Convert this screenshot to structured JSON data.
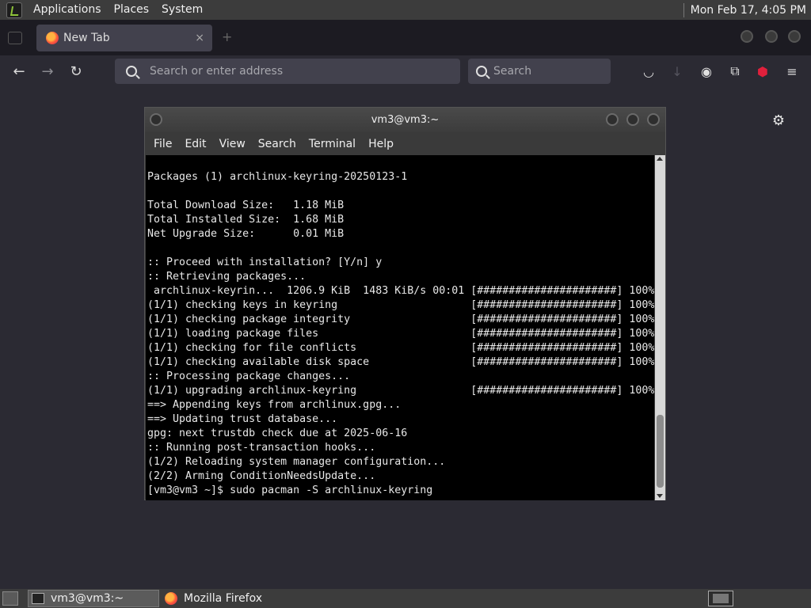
{
  "top_panel": {
    "menus": [
      "Applications",
      "Places",
      "System"
    ],
    "clock": "Mon Feb 17,  4:05 PM"
  },
  "firefox": {
    "tab": {
      "title": "New Tab",
      "close": "×"
    },
    "urlbar": {
      "placeholder": "Search or enter address"
    },
    "searchbar": {
      "placeholder": "Search"
    }
  },
  "terminal": {
    "title": "vm3@vm3:~",
    "menus": [
      "File",
      "Edit",
      "View",
      "Search",
      "Terminal",
      "Help"
    ],
    "lines": [
      "Packages (1) archlinux-keyring-20250123-1",
      "",
      "Total Download Size:   1.18 MiB",
      "Total Installed Size:  1.68 MiB",
      "Net Upgrade Size:      0.01 MiB",
      "",
      ":: Proceed with installation? [Y/n] y",
      ":: Retrieving packages...",
      " archlinux-keyrin...  1206.9 KiB  1483 KiB/s 00:01 [######################] 100%",
      "(1/1) checking keys in keyring                     [######################] 100%",
      "(1/1) checking package integrity                   [######################] 100%",
      "(1/1) loading package files                        [######################] 100%",
      "(1/1) checking for file conflicts                  [######################] 100%",
      "(1/1) checking available disk space                [######################] 100%",
      ":: Processing package changes...",
      "(1/1) upgrading archlinux-keyring                  [######################] 100%",
      "==> Appending keys from archlinux.gpg...",
      "==> Updating trust database...",
      "gpg: next trustdb check due at 2025-06-16",
      ":: Running post-transaction hooks...",
      "(1/2) Reloading system manager configuration...",
      "(2/2) Arming ConditionNeedsUpdate...",
      "[vm3@vm3 ~]$ sudo pacman -S archlinux-keyring"
    ]
  },
  "taskbar": {
    "tasks": [
      "vm3@vm3:~",
      "Mozilla Firefox"
    ]
  }
}
